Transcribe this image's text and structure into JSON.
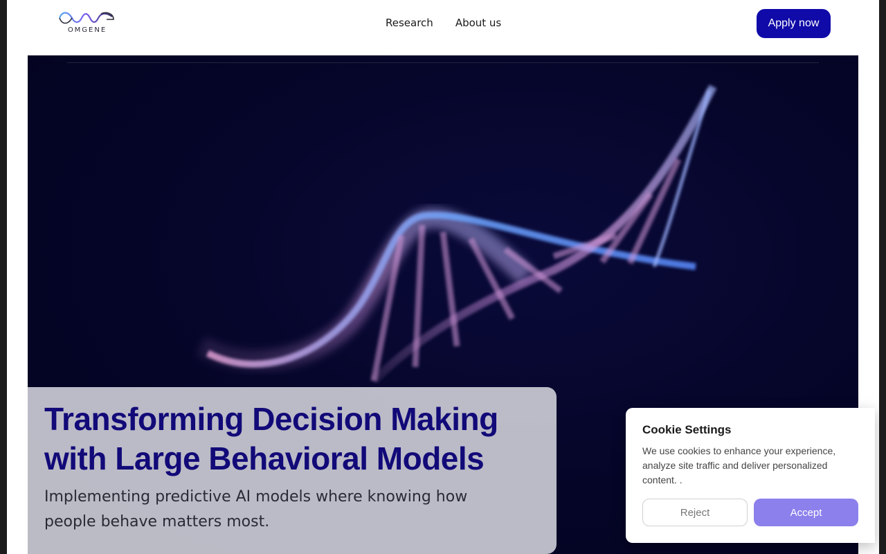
{
  "header": {
    "logo_text": "OMGENE",
    "logo_icon": "omg-wave-logo",
    "nav": [
      "Research",
      "About us"
    ],
    "cta_label": "Apply now"
  },
  "hero": {
    "image": "dna-double-helix",
    "title_line1": "Transforming Decision Making",
    "title_line2": "with Large Behavioral Models",
    "subtitle": "Implementing predictive AI models where knowing how people behave matters most."
  },
  "cookie": {
    "title": "Cookie Settings",
    "text": "We use cookies to enhance your experience, analyze site traffic and deliver personalized content. .",
    "reject_label": "Reject",
    "accept_label": "Accept"
  },
  "colors": {
    "brand": "#0f0aa8",
    "headline": "#120a78",
    "accept": "#8c80ec",
    "hero_bg": "#050528"
  }
}
